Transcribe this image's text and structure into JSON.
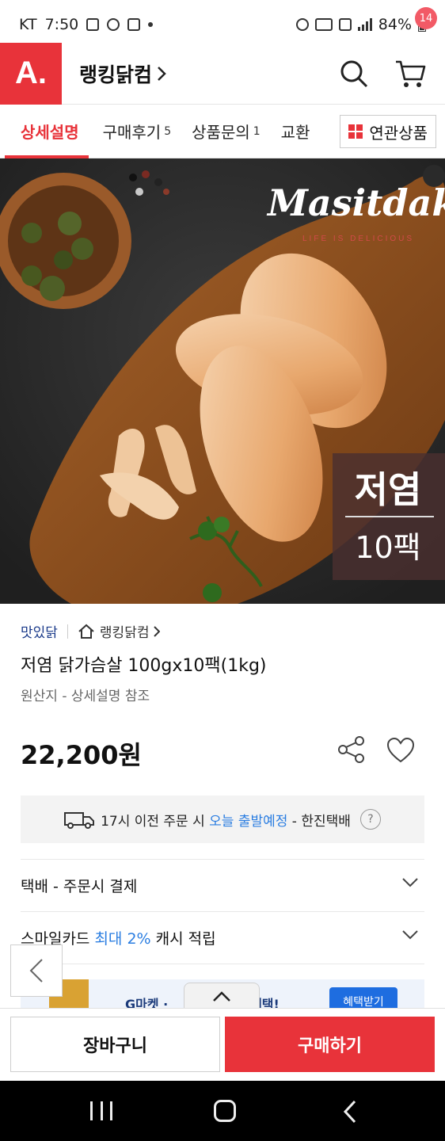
{
  "status_bar": {
    "carrier": "KT",
    "time": "7:50",
    "battery": "84%"
  },
  "header": {
    "logo_text": "A.",
    "store_name": "랭킹닭컴",
    "cart_count": "14"
  },
  "tabs": [
    {
      "label": "상세설명",
      "count": ""
    },
    {
      "label": "구매후기",
      "count": "5"
    },
    {
      "label": "상품문의",
      "count": "1"
    },
    {
      "label": "교환",
      "count": ""
    }
  ],
  "related_tab": "연관상품",
  "hero": {
    "brand_logo": "Masitdak",
    "brand_tagline": "LIFE IS DELICIOUS",
    "badge_top": "저염",
    "badge_bottom": "10팩"
  },
  "product": {
    "brand": "맛있닭",
    "shop": "랭킹닭컴",
    "title": "저염 닭가슴살 100gx10팩(1kg)",
    "origin": "원산지 - 상세설명 참조",
    "price": "22,200원"
  },
  "shipping": {
    "prefix": "17시 이전 주문 시 ",
    "highlight": "오늘 출발예정",
    "suffix": " - 한진택배",
    "help": "?"
  },
  "rows": {
    "delivery": "택배 - 주문시 결제",
    "card_prefix": "스마일카드 ",
    "card_highlight": "최대 2%",
    "card_suffix": " 캐시 적립"
  },
  "banner": {
    "text_left": "G마켓 · ",
    "text_right": "원 혜택!",
    "button": "혜택받기"
  },
  "actions": {
    "cart": "장바구니",
    "buy": "구매하기"
  },
  "colors": {
    "accent": "#e8333a",
    "link_blue": "#2a7de1",
    "brand_navy": "#1a3a8a"
  }
}
